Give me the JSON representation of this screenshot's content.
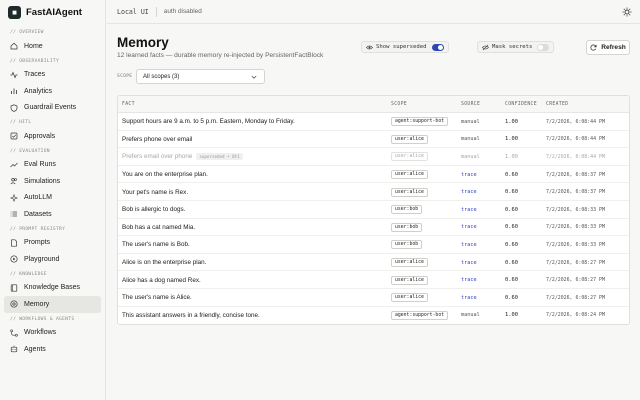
{
  "brand": {
    "name": "FastAIAgent"
  },
  "topbar": {
    "crumb": "Local UI",
    "auth": "auth disabled"
  },
  "sidebar": {
    "sections": [
      {
        "label": "// OVERVIEW",
        "items": [
          {
            "label": "Home",
            "icon": "home-icon"
          }
        ]
      },
      {
        "label": "// OBSERVABILITY",
        "items": [
          {
            "label": "Traces",
            "icon": "activity-icon"
          },
          {
            "label": "Analytics",
            "icon": "bar-chart-icon"
          },
          {
            "label": "Guardrail Events",
            "icon": "shield-icon"
          }
        ]
      },
      {
        "label": "// HITL",
        "items": [
          {
            "label": "Approvals",
            "icon": "check-square-icon"
          }
        ]
      },
      {
        "label": "// EVALUATION",
        "items": [
          {
            "label": "Eval Runs",
            "icon": "trend-icon"
          },
          {
            "label": "Simulations",
            "icon": "users-icon"
          },
          {
            "label": "AutoLLM",
            "icon": "sparkle-icon"
          },
          {
            "label": "Datasets",
            "icon": "list-icon"
          }
        ]
      },
      {
        "label": "// PROMPT REGISTRY",
        "items": [
          {
            "label": "Prompts",
            "icon": "file-icon"
          },
          {
            "label": "Playground",
            "icon": "play-icon"
          }
        ]
      },
      {
        "label": "// KNOWLEDGE",
        "items": [
          {
            "label": "Knowledge Bases",
            "icon": "book-icon"
          },
          {
            "label": "Memory",
            "icon": "memory-icon",
            "active": true
          }
        ]
      },
      {
        "label": "// WORKFLOWS & AGENTS",
        "items": [
          {
            "label": "Workflows",
            "icon": "workflow-icon"
          },
          {
            "label": "Agents",
            "icon": "agent-icon"
          }
        ]
      }
    ]
  },
  "page": {
    "title": "Memory",
    "subtitle": "12 learned facts — durable memory re-injected by PersistentFactBlock",
    "show_superseded": {
      "label": "Show superseded",
      "on": true
    },
    "mask_secrets": {
      "label": "Mask secrets",
      "on": false
    },
    "refresh_label": "Refresh",
    "scope_label": "SCOPE",
    "scope_value": "All scopes (3)"
  },
  "table": {
    "headers": {
      "fact": "FACT",
      "scope": "SCOPE",
      "source": "SOURCE",
      "confidence": "CONFIDENCE",
      "created": "CREATED"
    },
    "superseded_badge": "superseded • 0t1",
    "rows": [
      {
        "fact": "Support hours are 9 a.m. to 5 p.m. Eastern, Monday to Friday.",
        "scope": "agent:support-bot",
        "source": "manual",
        "confidence": "1.00",
        "created": "7/2/2026, 6:08:44 PM"
      },
      {
        "fact": "Prefers phone over email",
        "scope": "user:alice",
        "source": "manual",
        "confidence": "1.00",
        "created": "7/2/2026, 6:08:44 PM"
      },
      {
        "fact": "Prefers email over phone",
        "scope": "user:alice",
        "source": "manual",
        "confidence": "1.00",
        "created": "7/2/2026, 6:08:44 PM",
        "superseded": true
      },
      {
        "fact": "You are on the enterprise plan.",
        "scope": "user:alice",
        "source": "trace",
        "confidence": "0.60",
        "created": "7/2/2026, 6:08:37 PM"
      },
      {
        "fact": "Your pet's name is Rex.",
        "scope": "user:alice",
        "source": "trace",
        "confidence": "0.60",
        "created": "7/2/2026, 6:08:37 PM"
      },
      {
        "fact": "Bob is allergic to dogs.",
        "scope": "user:bob",
        "source": "trace",
        "confidence": "0.60",
        "created": "7/2/2026, 6:08:33 PM"
      },
      {
        "fact": "Bob has a cat named Mia.",
        "scope": "user:bob",
        "source": "trace",
        "confidence": "0.60",
        "created": "7/2/2026, 6:08:33 PM"
      },
      {
        "fact": "The user's name is Bob.",
        "scope": "user:bob",
        "source": "trace",
        "confidence": "0.60",
        "created": "7/2/2026, 6:08:33 PM"
      },
      {
        "fact": "Alice is on the enterprise plan.",
        "scope": "user:alice",
        "source": "trace",
        "confidence": "0.60",
        "created": "7/2/2026, 6:08:27 PM"
      },
      {
        "fact": "Alice has a dog named Rex.",
        "scope": "user:alice",
        "source": "trace",
        "confidence": "0.60",
        "created": "7/2/2026, 6:08:27 PM"
      },
      {
        "fact": "The user's name is Alice.",
        "scope": "user:alice",
        "source": "trace",
        "confidence": "0.60",
        "created": "7/2/2026, 6:08:27 PM"
      },
      {
        "fact": "This assistant answers in a friendly, concise tone.",
        "scope": "agent:support-bot",
        "source": "manual",
        "confidence": "1.00",
        "created": "7/2/2026, 6:08:24 PM"
      }
    ]
  }
}
